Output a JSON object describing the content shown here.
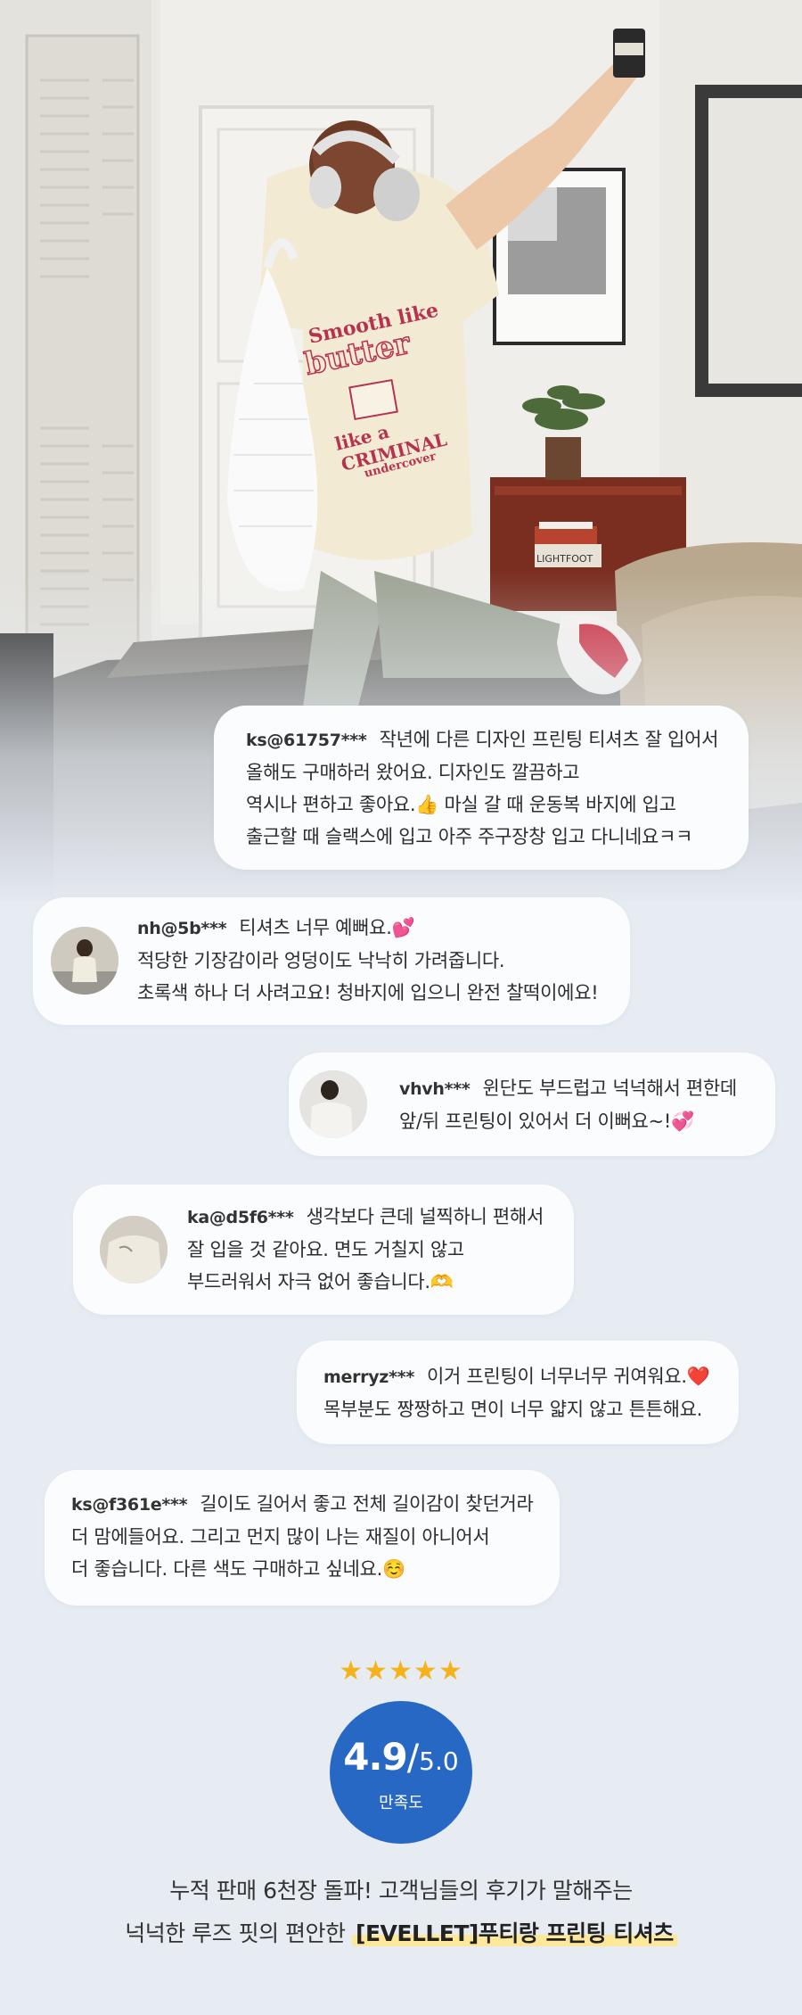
{
  "photo": {
    "shirt_print": {
      "line1": "Smooth like",
      "line2": "butter",
      "line3": "like a",
      "line4": "CRIMINAL",
      "line5": "undercover"
    },
    "book_spine": "LIGHTFOOT"
  },
  "reviews": [
    {
      "user": "ks@61757***",
      "has_avatar": false,
      "lines": [
        "작년에 다른 디자인 프린팅 티셔츠 잘 입어서",
        "올해도 구매하러 왔어요. 디자인도 깔끔하고",
        "역시나 편하고 좋아요.👍 마실 갈 때 운동복 바지에 입고",
        "출근할 때 슬랙스에 입고 아주 주구장창 입고 다니네요ㅋㅋ"
      ]
    },
    {
      "user": "nh@5b***",
      "has_avatar": true,
      "lines": [
        "티셔츠 너무 예뻐요.💕",
        "적당한 기장감이라 엉덩이도 낙낙히 가려줍니다.",
        "초록색 하나 더 사려고요! 청바지에 입으니 완전 찰떡이에요!"
      ]
    },
    {
      "user": "vhvh***",
      "has_avatar": true,
      "lines": [
        "윈단도 부드럽고 넉넉해서 편한데",
        "앞/뒤 프린팅이 있어서 더 이뻐요~!💞"
      ]
    },
    {
      "user": "ka@d5f6***",
      "has_avatar": true,
      "lines": [
        "생각보다 큰데 널찍하니 편해서",
        "잘 입을 것 같아요. 면도 거칠지 않고",
        "부드러워서 자극 없어 좋습니다.🫶"
      ]
    },
    {
      "user": "merryz***",
      "has_avatar": false,
      "lines": [
        "이거 프린팅이 너무너무 귀여워요.❤️",
        "목부분도 짱짱하고 면이 너무 얇지 않고 튼튼해요."
      ]
    },
    {
      "user": "ks@f361e***",
      "has_avatar": false,
      "lines": [
        "길이도 길어서 좋고 전체 길이감이 찾던거라",
        "더 맘에들어요. 그리고 먼지 많이 나는 재질이 아니어서",
        "더 좋습니다. 다른 색도 구매하고 싶네요.☺️"
      ]
    }
  ],
  "rating": {
    "stars": "★★★★★",
    "score": "4.9",
    "slash": "/",
    "max": "5.0",
    "label": "만족도"
  },
  "footer": {
    "line1": "누적 판매 6천장 돌파! 고객님들의 후기가 말해주는",
    "line2_prefix": "넉넉한 루즈 핏의 편안한 ",
    "line2_highlight": "[EVELLET]푸티랑 프린팅 티셔츠"
  },
  "colors": {
    "background": "#e7ecf3",
    "bubble": "#fbfcfe",
    "rating_circle": "#2768c4",
    "stars": "#f6b21b",
    "highlight": "#fde89a",
    "print": "#b5334f"
  }
}
